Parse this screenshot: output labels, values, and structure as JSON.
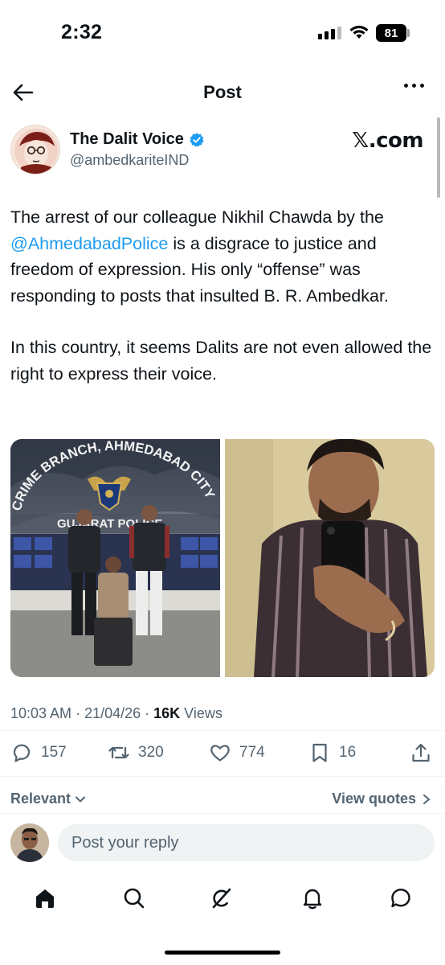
{
  "status_bar": {
    "time": "2:32",
    "battery": "81"
  },
  "header": {
    "title": "Post"
  },
  "author": {
    "name": "The Dalit Voice",
    "handle": "@ambedkariteIND",
    "source": "𝕏.com",
    "verified": true
  },
  "post": {
    "paragraph1_before": "The arrest of our colleague Nikhil Chawda by the ",
    "mention": "@AhmedabadPolice",
    "paragraph1_after": " is a disgrace to justice and freedom of expression. His only “offense” was responding to posts that insulted B. R. Ambedkar.",
    "paragraph2": "In this country, it seems Dalits are not even allowed the right to express their voice."
  },
  "media": {
    "left_sign": "CRIME BRANCH, AHMEDABAD CITY",
    "left_sub_sign": "GUJARAT POLICE"
  },
  "meta": {
    "time": "10:03 AM",
    "sep1": " · ",
    "date": "21/04/26",
    "sep2": " · ",
    "views_count": "16K",
    "views_label": " Views"
  },
  "actions": {
    "replies": "157",
    "reposts": "320",
    "likes": "774",
    "bookmarks": "16"
  },
  "sorting": {
    "relevant": "Relevant",
    "view_quotes": "View quotes"
  },
  "reply": {
    "placeholder": "Post your reply"
  },
  "colors": {
    "accent": "#1d9bf0",
    "text": "#0f1419",
    "secondary": "#536471"
  },
  "tabs": [
    "home-icon",
    "search-icon",
    "grok-icon",
    "notifications-icon",
    "messages-icon"
  ]
}
